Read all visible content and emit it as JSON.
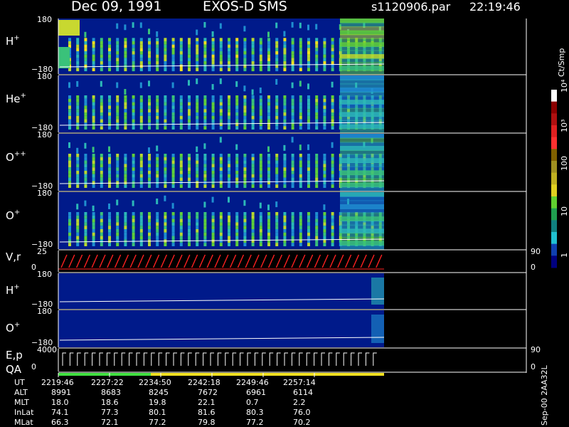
{
  "header": {
    "date": "Dec 09, 1991",
    "instrument": "EXOS-D SMS",
    "file": "s1120906.par",
    "time": "22:19:46"
  },
  "panels": [
    {
      "species": "H",
      "charge": "+",
      "ytop": "180",
      "ybot": "−180"
    },
    {
      "species": "He",
      "charge": "+",
      "ytop": "180",
      "ybot": "−180"
    },
    {
      "species": "O",
      "charge": "++",
      "ytop": "180",
      "ybot": "−180"
    },
    {
      "species": "O",
      "charge": "+",
      "ytop": "180",
      "ybot": "−180"
    },
    {
      "species": "V,r",
      "charge": "",
      "ytop": "25",
      "ybot": "0",
      "right_top": "90",
      "right_bot": "0"
    },
    {
      "species": "H",
      "charge": "+",
      "ytop": "180",
      "ybot": "−180"
    },
    {
      "species": "O",
      "charge": "+",
      "ytop": "180",
      "ybot": "−180"
    },
    {
      "species": "E,p",
      "charge": "",
      "ytop": "4000",
      "ybot": "0",
      "right_top": "90",
      "right_bot": "0"
    }
  ],
  "qa_label": "QA",
  "colorbar": {
    "unit": "Ct/Smp",
    "labels": [
      "10⁴",
      "10³",
      "100",
      "10",
      "1"
    ]
  },
  "side_note": "Sep-00 2AA32L",
  "chart_data": {
    "type": "heatmap",
    "x_label": "UT",
    "time_range": [
      "22:19:46",
      "22:57:14"
    ],
    "scale": "log",
    "color_range": [
      1,
      10000
    ],
    "ephemeris": {
      "rows": [
        "UT",
        "ALT",
        "MLT",
        "InLat",
        "MLat"
      ],
      "columns": [
        [
          "2219:46",
          "8991",
          "18.0",
          "74.1",
          "66.3"
        ],
        [
          "2227:22",
          "8683",
          "18.6",
          "77.3",
          "72.1"
        ],
        [
          "2234:50",
          "8245",
          "19.8",
          "80.1",
          "77.2"
        ],
        [
          "2242:18",
          "7672",
          "22.1",
          "81.6",
          "79.8"
        ],
        [
          "2249:46",
          "6961",
          "0.7",
          "80.3",
          "77.2"
        ],
        [
          "2257:14",
          "6114",
          "2.2",
          "76.0",
          "70.2"
        ]
      ]
    }
  }
}
